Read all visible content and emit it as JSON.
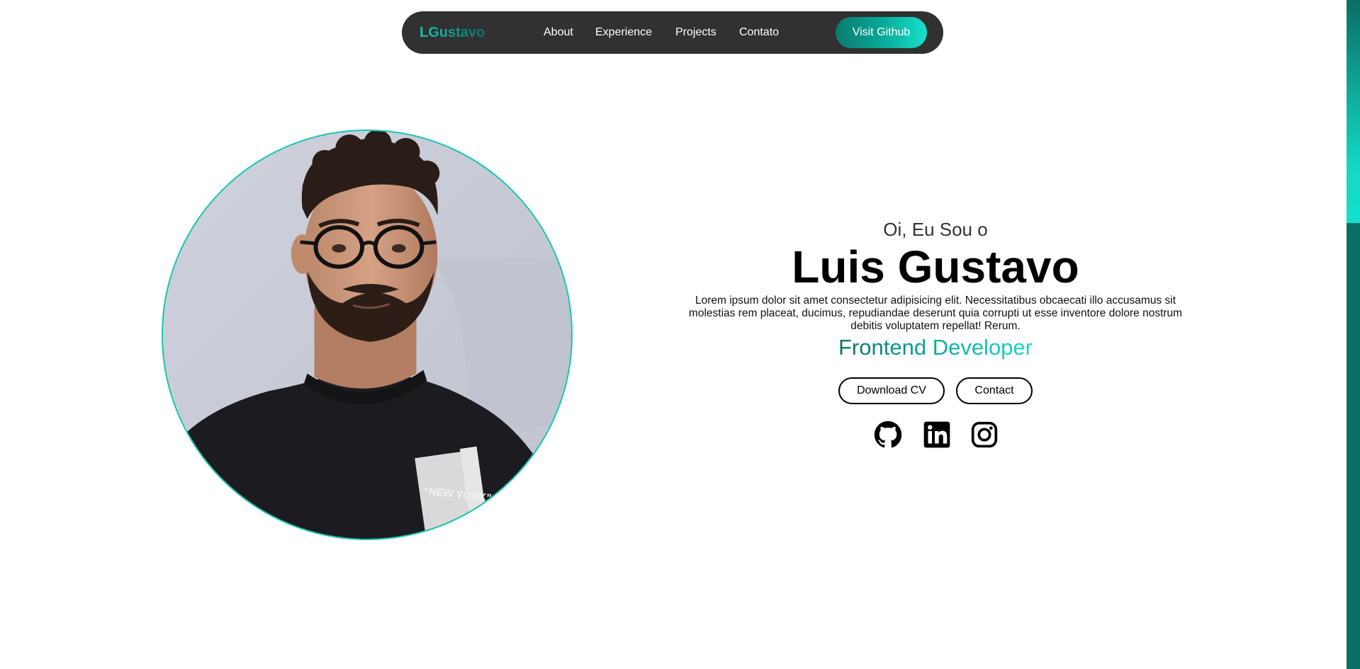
{
  "nav": {
    "logo": "LGustavo",
    "links": [
      {
        "label": "About"
      },
      {
        "label": "Experience"
      },
      {
        "label": "Projects"
      },
      {
        "label": "Contato"
      }
    ],
    "cta_label": "Visit Github"
  },
  "hero": {
    "greeting": "Oi, Eu Sou o",
    "name": "Luis Gustavo",
    "bio": "Lorem ipsum dolor sit amet consectetur adipisicing elit. Necessitatibus obcaecati illo accusamus sit molestias rem placeat, ducimus, repudiandae deserunt quia corrupti ut esse inventore dolore nostrum debitis voluptatem repellat! Rerum.",
    "role": "Frontend Developer",
    "buttons": {
      "download_label": "Download CV",
      "contact_label": "Contact"
    },
    "socials": [
      {
        "icon": "github-icon"
      },
      {
        "icon": "linkedin-icon"
      },
      {
        "icon": "instagram-icon"
      }
    ],
    "photo_shirt_text": "“NEW YORK”"
  },
  "theme": {
    "accent": "#11c7b3",
    "accent_dark": "#0a6e64",
    "navbar_bg": "#313131"
  }
}
